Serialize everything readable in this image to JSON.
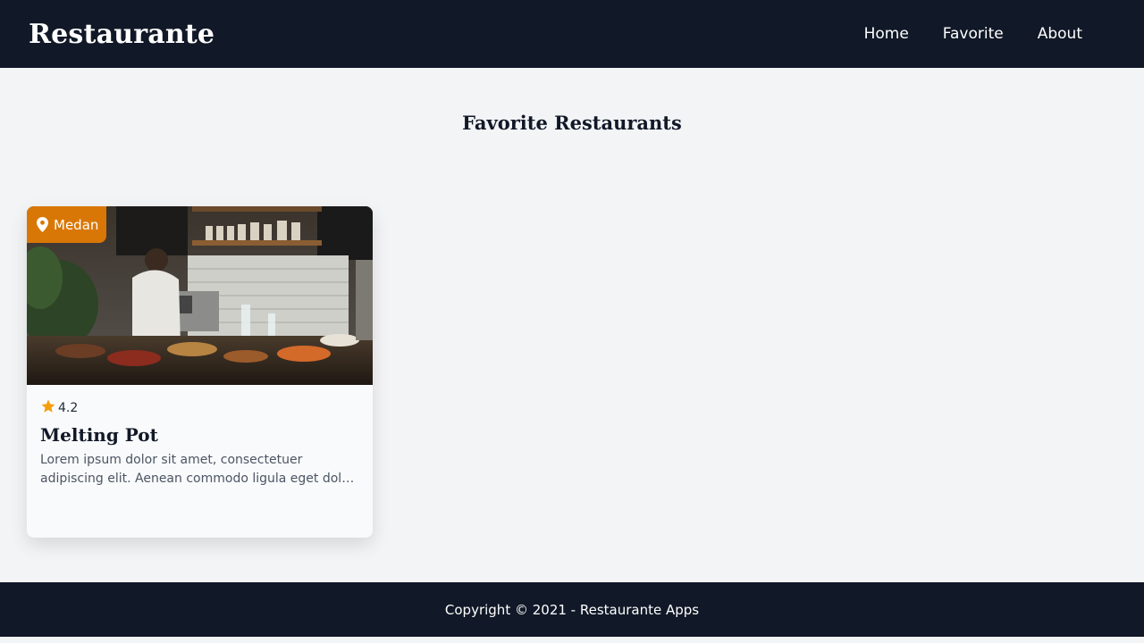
{
  "header": {
    "brand": "Restaurante",
    "nav": [
      {
        "label": "Home"
      },
      {
        "label": "Favorite"
      },
      {
        "label": "About"
      }
    ]
  },
  "main": {
    "title": "Favorite Restaurants",
    "restaurants": [
      {
        "city": "Medan",
        "city_icon": "map-pin-icon",
        "rating": "4.2",
        "rating_icon": "star-icon",
        "name": "Melting Pot",
        "description": "Lorem ipsum dolor sit amet, consectetuer adipiscing elit. Aenean commodo ligula eget dolor. Aenean massa.",
        "image_subject": "restaurant kitchen counter photo"
      }
    ]
  },
  "footer": {
    "copyright": "Copyright © 2021 - Restaurante Apps"
  },
  "colors": {
    "header_bg": "#111827",
    "page_bg": "#f3f4f6",
    "badge_bg": "#d97706",
    "star": "#f59e0b"
  }
}
